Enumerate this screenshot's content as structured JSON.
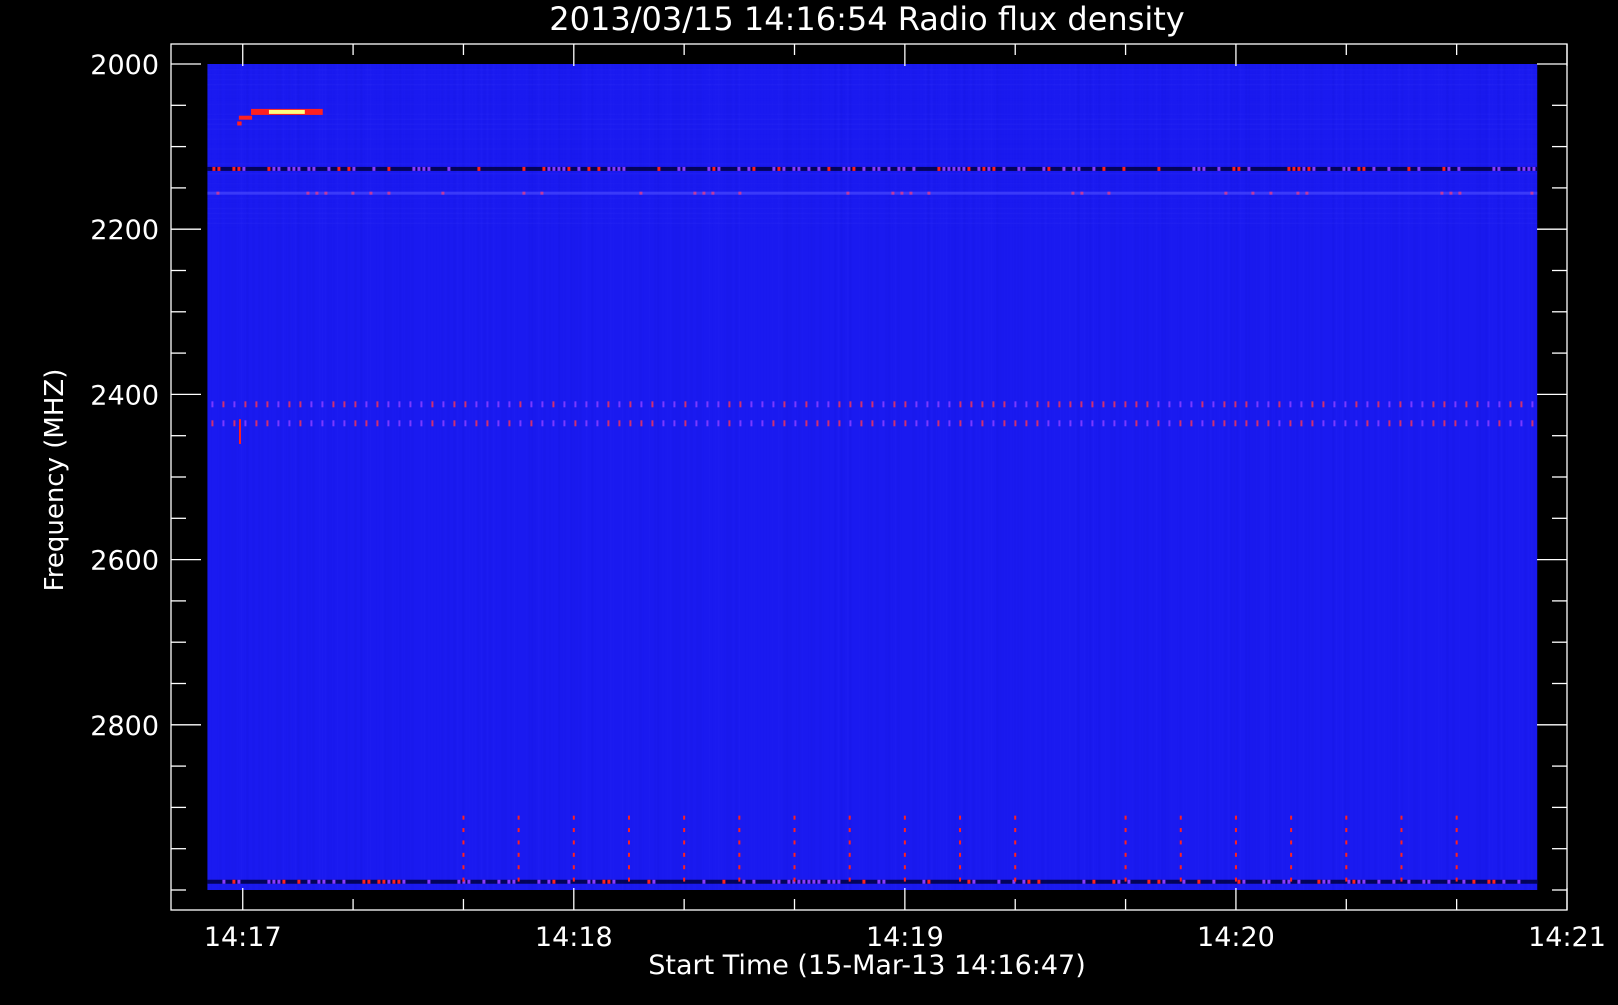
{
  "colors": {
    "background": "#000000",
    "axis": "#ffffff",
    "spectrogram_base": "#1a1af0",
    "hot": "#ff2020",
    "peak": "#ffff80",
    "dark": "#000040"
  },
  "chart_data": {
    "type": "heatmap",
    "title": "2013/03/15 14:16:54 Radio flux density",
    "xlabel": "Start Time (15-Mar-13 14:16:47)",
    "ylabel": "Frequency (MHZ)",
    "x_range_seconds": [
      0,
      253
    ],
    "x_unit_note": "seconds after 14:16:47",
    "x_major_ticks": [
      {
        "label": "14:17",
        "value": 13
      },
      {
        "label": "14:18",
        "value": 73
      },
      {
        "label": "14:19",
        "value": 133
      },
      {
        "label": "14:20",
        "value": 193
      },
      {
        "label": "14:21",
        "value": 253
      }
    ],
    "x_minor_step_seconds": 20,
    "ylim": [
      2000,
      3000
    ],
    "y_inverted": true,
    "y_major_ticks": [
      {
        "label": "2000",
        "value": 2000
      },
      {
        "label": "2200",
        "value": 2200
      },
      {
        "label": "2400",
        "value": 2400
      },
      {
        "label": "2600",
        "value": 2600
      },
      {
        "label": "2800",
        "value": 2800
      }
    ],
    "y_minor_step": 50,
    "data_time_range_seconds": [
      6.6,
      247.6
    ],
    "data_freq_range": [
      2000,
      3000
    ],
    "features": [
      {
        "kind": "burst",
        "freq": 2058,
        "time_start": 14.5,
        "time_end": 27.5,
        "intensity": "peak"
      },
      {
        "kind": "burst",
        "freq": 2065,
        "time_start": 12.3,
        "time_end": 14.7,
        "intensity": "hot"
      },
      {
        "kind": "burst",
        "freq": 2072,
        "time_start": 12.0,
        "time_end": 12.8,
        "intensity": "hot"
      },
      {
        "kind": "spike",
        "freq_start": 2430,
        "freq_end": 2460,
        "time": 12.5,
        "intensity": "hot"
      },
      {
        "kind": "band",
        "freq": 2127,
        "time_start": 6.6,
        "time_end": 247.6,
        "intensity": "mixed"
      },
      {
        "kind": "band",
        "freq": 2157,
        "time_start": 6.6,
        "time_end": 247.6,
        "intensity": "faint"
      },
      {
        "kind": "band",
        "freq": 2412,
        "time_start": 6.6,
        "time_end": 247.6,
        "intensity": "dotted"
      },
      {
        "kind": "band",
        "freq": 2435,
        "time_start": 6.6,
        "time_end": 247.6,
        "intensity": "dotted"
      },
      {
        "kind": "band",
        "freq": 2990,
        "time_start": 6.6,
        "time_end": 247.6,
        "intensity": "mixed"
      },
      {
        "kind": "periodic-spikes",
        "freq_start": 2910,
        "freq_end": 2985,
        "times": [
          53,
          63,
          73,
          83,
          93,
          103,
          113,
          123,
          133,
          143,
          153,
          173,
          183,
          193,
          203,
          213,
          223,
          233
        ],
        "intensity": "hot"
      }
    ]
  }
}
